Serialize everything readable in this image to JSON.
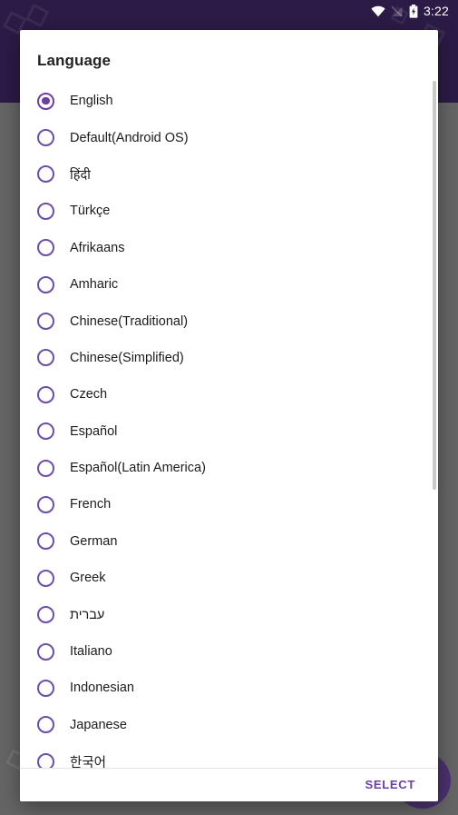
{
  "status_bar": {
    "wifi_icon": "wifi-icon",
    "signal_off_icon": "signal-off-icon",
    "battery_icon": "battery-charging-icon",
    "time": "3:22"
  },
  "background": {
    "fab_icon": "send-icon"
  },
  "dialog": {
    "title": "Language",
    "selected_value": "English",
    "options": [
      {
        "label": "English",
        "selected": true
      },
      {
        "label": "Default(Android OS)",
        "selected": false
      },
      {
        "label": "हिंदी",
        "selected": false
      },
      {
        "label": "Türkçe",
        "selected": false
      },
      {
        "label": "Afrikaans",
        "selected": false
      },
      {
        "label": "Amharic",
        "selected": false
      },
      {
        "label": "Chinese(Traditional)",
        "selected": false
      },
      {
        "label": "Chinese(Simplified)",
        "selected": false
      },
      {
        "label": "Czech",
        "selected": false
      },
      {
        "label": "Español",
        "selected": false
      },
      {
        "label": "Español(Latin America)",
        "selected": false
      },
      {
        "label": "French",
        "selected": false
      },
      {
        "label": "German",
        "selected": false
      },
      {
        "label": "Greek",
        "selected": false
      },
      {
        "label": "עברית",
        "selected": false
      },
      {
        "label": "Italiano",
        "selected": false
      },
      {
        "label": "Indonesian",
        "selected": false
      },
      {
        "label": "Japanese",
        "selected": false
      },
      {
        "label": "한국어",
        "selected": false
      }
    ],
    "select_label": "SELECT"
  },
  "colors": {
    "accent": "#6b3fa0",
    "appbar": "#2c1b46",
    "scrim": "#656565",
    "dialog_bg": "#ffffff",
    "text": "#1b1b1b"
  }
}
